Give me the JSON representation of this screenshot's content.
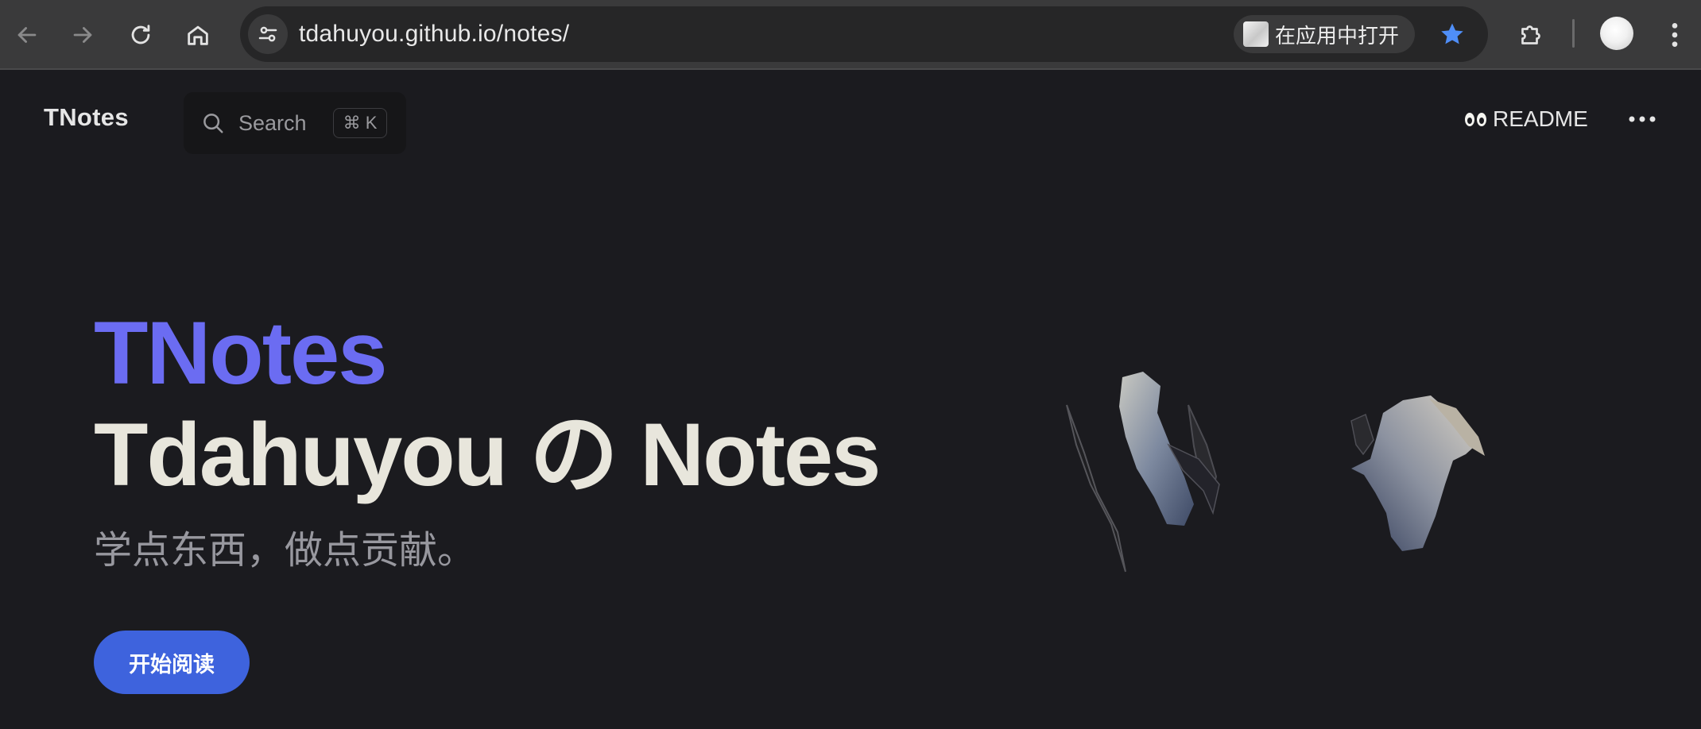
{
  "browser": {
    "url": "tdahuyou.github.io/notes/",
    "open_in_app_label": "在应用中打开",
    "icons": {
      "back": "arrow-left-icon",
      "forward": "arrow-right-icon",
      "reload": "reload-icon",
      "home": "home-icon",
      "site_info": "tune-icon",
      "bookmark": "star-icon",
      "extensions": "puzzle-icon",
      "profile": "avatar",
      "menu": "kebab-menu-icon"
    },
    "bookmark_color": "#4f8ef7"
  },
  "nav": {
    "brand": "TNotes",
    "search_label": "Search",
    "search_shortcut": "⌘ K",
    "readme_label": "README",
    "readme_icon": "eyes-emoji"
  },
  "hero": {
    "name": "TNotes",
    "text": "Tdahuyou の Notes",
    "tagline": "学点东西，做点贡献。",
    "cta_label": "开始阅读",
    "name_color": "#6b6cf2",
    "cta_color": "#3e63dd"
  }
}
